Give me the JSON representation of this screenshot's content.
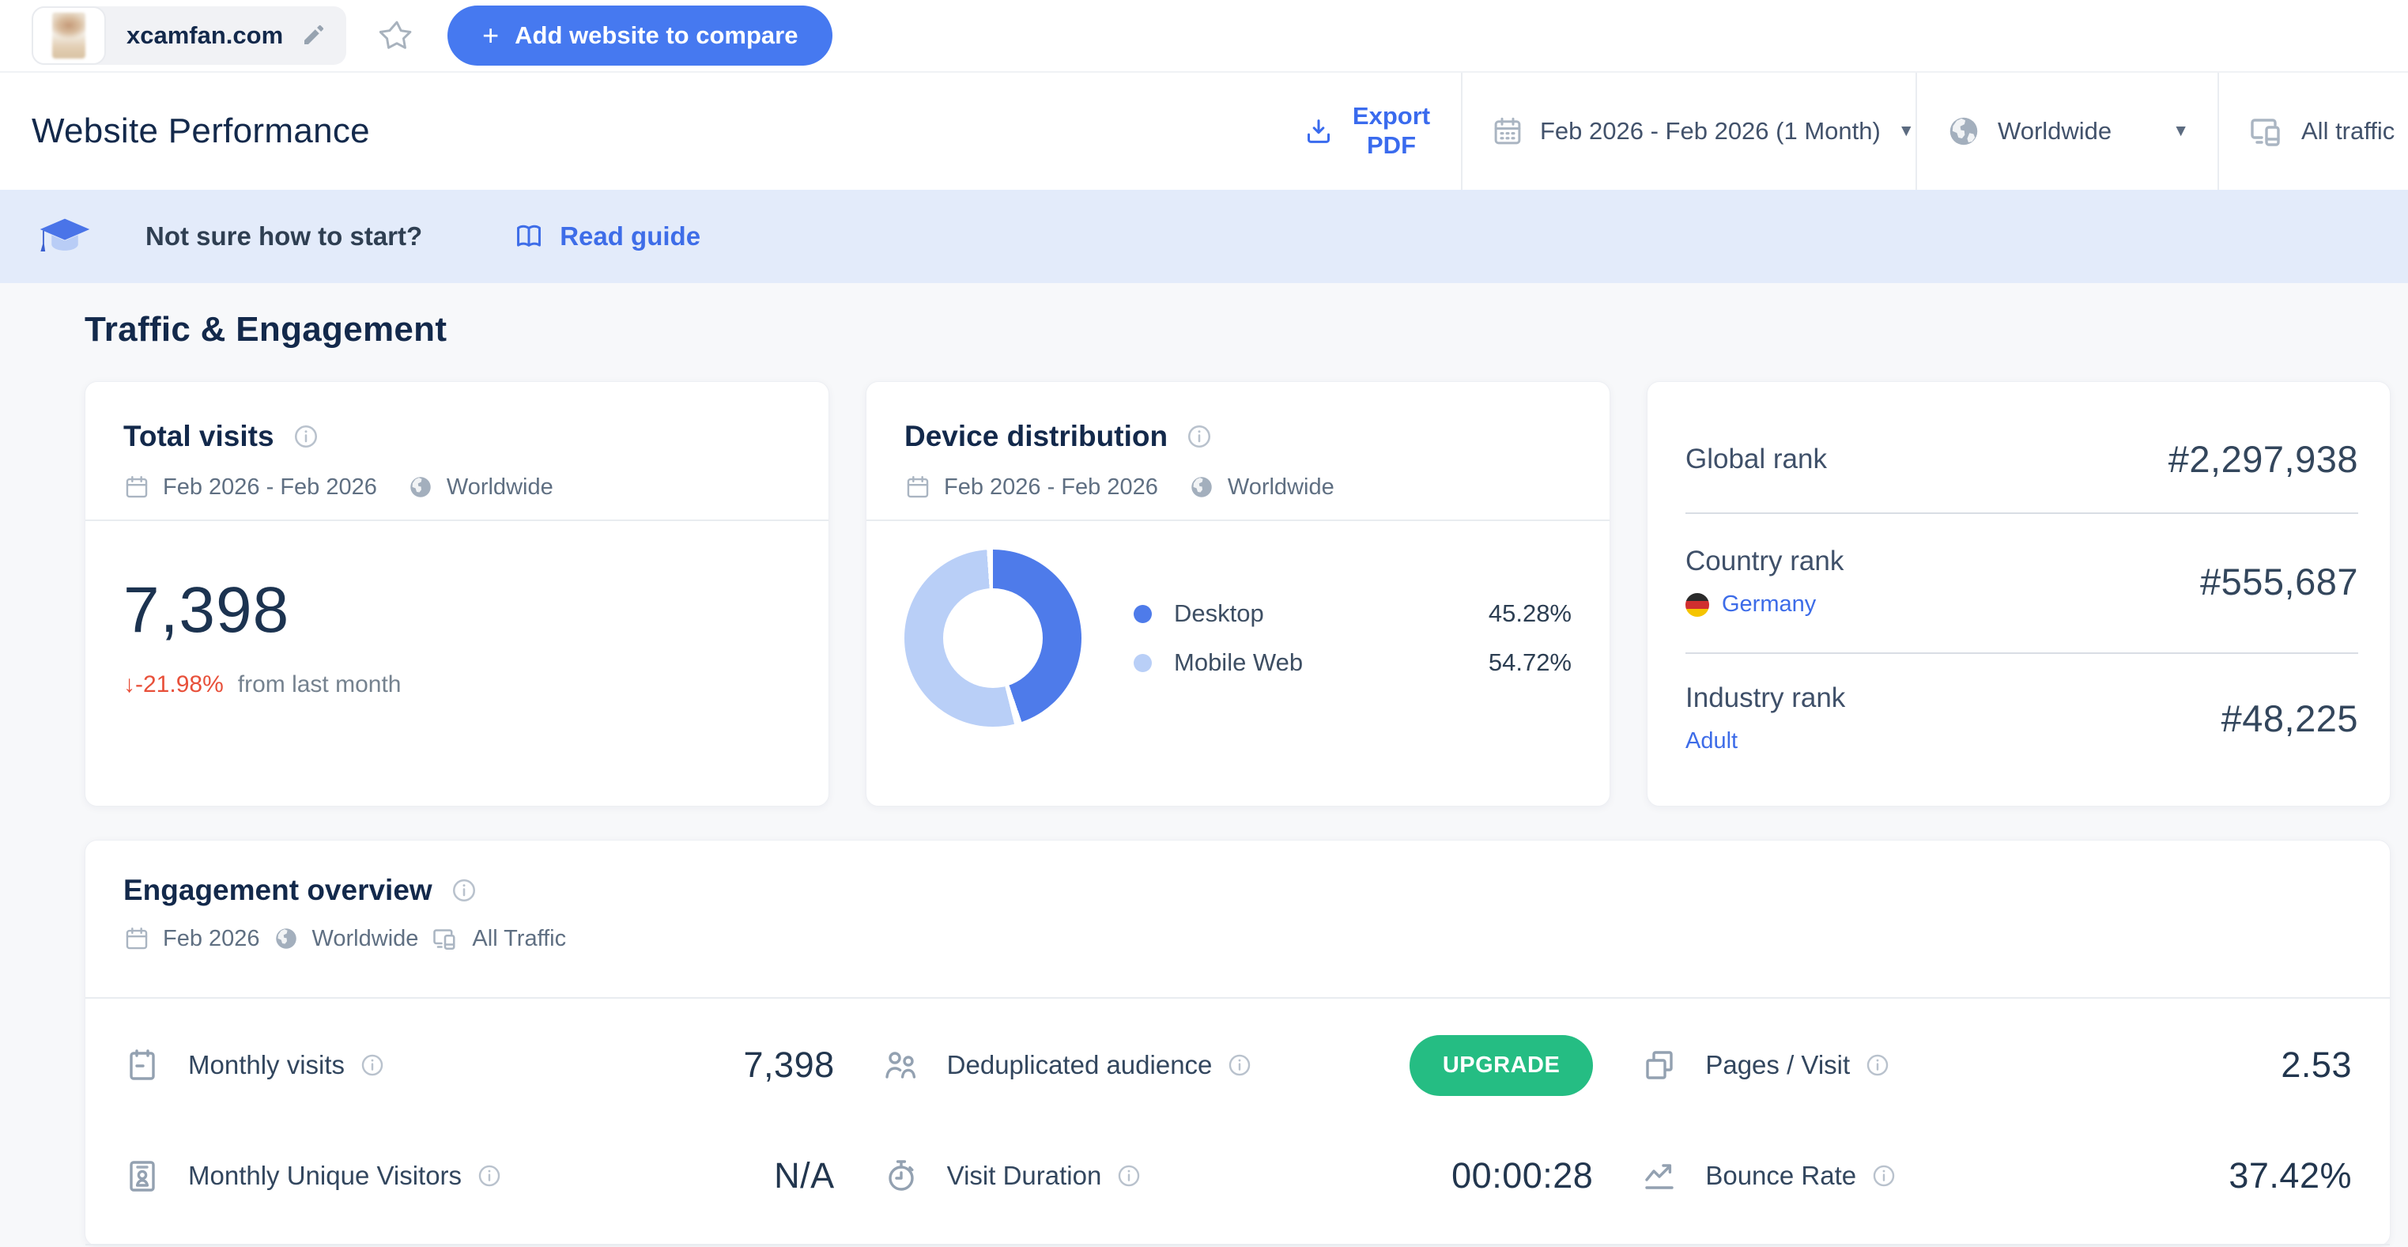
{
  "icons": {
    "dropdown": "▼",
    "plus": "+"
  },
  "colors": {
    "accent_blue": "#4679f0",
    "link_blue": "#3e6de8",
    "title_navy": "#13294b",
    "green": "#25bd83",
    "red": "#e8503a",
    "donut_desktop": "#4e7bea",
    "donut_mobile": "#b9cff7",
    "banner_bg": "#e3ebfa"
  },
  "topbar": {
    "website": "xcamfan.com",
    "compare_button": "Add website to compare"
  },
  "header": {
    "title": "Website Performance",
    "export_label": "Export PDF",
    "date_range": "Feb 2026 - Feb 2026 (1 Month)",
    "region": "Worldwide",
    "traffic_filter": "All traffic"
  },
  "banner": {
    "text": "Not sure how to start?",
    "link": "Read guide"
  },
  "section_title": "Traffic & Engagement",
  "total_visits": {
    "title": "Total visits",
    "date_range": "Feb 2026 - Feb 2026",
    "region": "Worldwide",
    "value": "7,398",
    "change": "↓-21.98%",
    "change_note": "from last month"
  },
  "device_distribution": {
    "title": "Device distribution",
    "date_range": "Feb 2026 - Feb 2026",
    "region": "Worldwide",
    "chart": {
      "type": "pie",
      "categories": [
        "Desktop",
        "Mobile Web"
      ],
      "values": [
        45.28,
        54.72
      ],
      "colors": [
        "#4e7bea",
        "#b9cff7"
      ]
    },
    "legend": [
      {
        "label": "Desktop",
        "pct": "45.28%"
      },
      {
        "label": "Mobile Web",
        "pct": "54.72%"
      }
    ]
  },
  "ranks": [
    {
      "label": "Global rank",
      "value": "#2,297,938"
    },
    {
      "label": "Country rank",
      "link": "Germany",
      "value": "#555,687"
    },
    {
      "label": "Industry rank",
      "link": "Adult",
      "value": "#48,225"
    }
  ],
  "engagement": {
    "title": "Engagement overview",
    "date": "Feb 2026",
    "region": "Worldwide",
    "traffic": "All Traffic",
    "metrics": [
      {
        "label": "Monthly visits",
        "value": "7,398"
      },
      {
        "label": "Deduplicated audience",
        "value": "UPGRADE"
      },
      {
        "label": "Pages / Visit",
        "value": "2.53"
      },
      {
        "label": "Monthly Unique Visitors",
        "value": "N/A"
      },
      {
        "label": "Visit Duration",
        "value": "00:00:28"
      },
      {
        "label": "Bounce Rate",
        "value": "37.42%"
      }
    ]
  }
}
